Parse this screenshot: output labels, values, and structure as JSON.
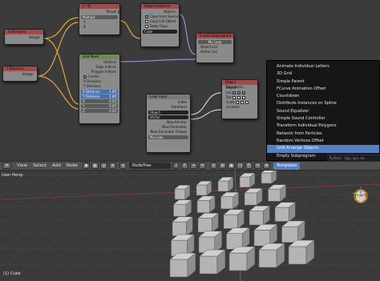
{
  "nodes": {
    "math": {
      "title": "x * B",
      "mode": "Multiply",
      "socket_a": "A",
      "socket_b": "B"
    },
    "object_instancer": {
      "title": "Object Instancer",
      "output": "Objects",
      "copy_from_source": "Copy from Source",
      "copy_full_object": "Copy Full Object",
      "deep_copy": "Deep Copy",
      "object_field": "Cube"
    },
    "x_divisions": {
      "title": "X Divisions",
      "field": "Integer"
    },
    "y_divisions": {
      "title": "Y Divisions",
      "field": "Integer"
    },
    "invoke_subprogram": {
      "title": "Invoke Subprogram",
      "program": "My Loop",
      "out_object_list": "Object List",
      "out_vector_list": "Vector List"
    },
    "grid_mesh": {
      "title": "Grid Mesh",
      "outputs": [
        "Vertices",
        "Edge Indices",
        "Polygon Indices"
      ],
      "center": "Center",
      "x_div": "X Divisions",
      "y_div": "Y Divisions",
      "x_dist_label": "X Distance",
      "x_dist_value": "1.00",
      "y_dist_label": "Y Distance",
      "y_dist_value": "1.00",
      "offset_x": "X",
      "offset_y": "Y",
      "offset_z": "Z",
      "offset_x_val": "0.00",
      "offset_y_val": "0.00",
      "offset_z_val": "0.00"
    },
    "loop_input": {
      "title": "Loop Input",
      "outputs": [
        "Index",
        "Iterations"
      ],
      "object": "Object",
      "vector": "Vector",
      "new_iterator": "New Iterator",
      "new_parameter": "New Parameter",
      "new_generator": "New Generator Output",
      "loop_name": "My Loop"
    },
    "object_transforms": {
      "title": "Object Transforms...",
      "object_label": "Object",
      "loc": "Loc",
      "rot": "Rot",
      "scale": "Scale",
      "location": "Location"
    }
  },
  "templates_menu": {
    "items": [
      "Animate Individual Letters",
      "3D Grid",
      "Simple Parent",
      "FCurve Animation Offset",
      "Countdown",
      "Distribute Instances on Spline",
      "Sound Equalizer",
      "Simple Sound Controller",
      "Transform Individual Polygons",
      "Network from Particles",
      "Random Vertices Offset",
      "Grid Arrange Objects",
      "Empty Subprogram"
    ],
    "highlighted_index": 11,
    "python_tooltip": "Python: bpy.ops.an..."
  },
  "header": {
    "menus": [
      "View",
      "Select",
      "Add",
      "Node"
    ],
    "tree_name": "NodeTree",
    "users": "2",
    "templates_label": "Templates"
  },
  "viewport": {
    "view_label": "User Persp",
    "object_label": "(1) Cube",
    "grid_columns": 5,
    "grid_rows": 5
  },
  "colors": {
    "node_header_red": "#a24a4a",
    "node_header_green": "#6f8a55",
    "menu_highlight": "#5680c2",
    "wire": "#e8a33a",
    "wire_purple": "#a08ad8"
  }
}
